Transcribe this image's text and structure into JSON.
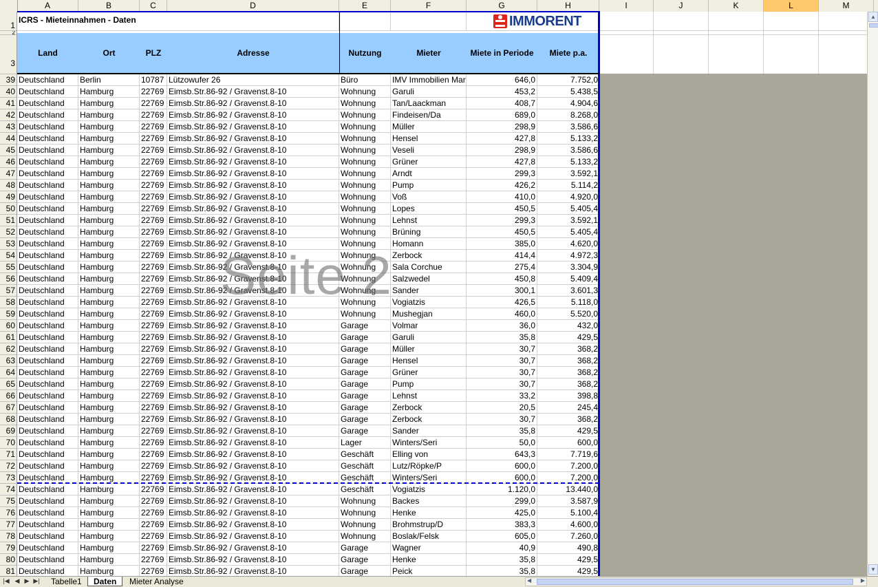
{
  "columns": [
    "A",
    "B",
    "C",
    "D",
    "E",
    "F",
    "G",
    "H",
    "I",
    "J",
    "K",
    "L",
    "M"
  ],
  "active_column": "L",
  "title_cell": "ICRS - Mieteinnahmen - Daten",
  "logo_text": "IMMORENT",
  "header_rows": [
    "1",
    "2",
    "3"
  ],
  "headers": [
    "Land",
    "Ort",
    "PLZ",
    "Adresse",
    "Nutzung",
    "Mieter",
    "Miete in Periode",
    "Miete p.a."
  ],
  "watermark": "Seite 2",
  "rows": [
    {
      "n": "39",
      "land": "Deutschland",
      "ort": "Berlin",
      "plz": "10787",
      "adr": "Lützowufer 26",
      "nutz": "Büro",
      "mieter": "IMV Immobilien Mar",
      "periode": "646,0",
      "pa": "7.752,0"
    },
    {
      "n": "40",
      "land": "Deutschland",
      "ort": "Hamburg",
      "plz": "22769",
      "adr": "Eimsb.Str.86-92 / Gravenst.8-10",
      "nutz": "Wohnung",
      "mieter": "Garuli",
      "periode": "453,2",
      "pa": "5.438,5"
    },
    {
      "n": "41",
      "land": "Deutschland",
      "ort": "Hamburg",
      "plz": "22769",
      "adr": "Eimsb.Str.86-92 / Gravenst.8-10",
      "nutz": "Wohnung",
      "mieter": "Tan/Laackman",
      "periode": "408,7",
      "pa": "4.904,6"
    },
    {
      "n": "42",
      "land": "Deutschland",
      "ort": "Hamburg",
      "plz": "22769",
      "adr": "Eimsb.Str.86-92 / Gravenst.8-10",
      "nutz": "Wohnung",
      "mieter": "Findeisen/Da",
      "periode": "689,0",
      "pa": "8.268,0"
    },
    {
      "n": "43",
      "land": "Deutschland",
      "ort": "Hamburg",
      "plz": "22769",
      "adr": "Eimsb.Str.86-92 / Gravenst.8-10",
      "nutz": "Wohnung",
      "mieter": "Müller",
      "periode": "298,9",
      "pa": "3.586,6"
    },
    {
      "n": "44",
      "land": "Deutschland",
      "ort": "Hamburg",
      "plz": "22769",
      "adr": "Eimsb.Str.86-92 / Gravenst.8-10",
      "nutz": "Wohnung",
      "mieter": "Hensel",
      "periode": "427,8",
      "pa": "5.133,2"
    },
    {
      "n": "45",
      "land": "Deutschland",
      "ort": "Hamburg",
      "plz": "22769",
      "adr": "Eimsb.Str.86-92 / Gravenst.8-10",
      "nutz": "Wohnung",
      "mieter": "Veseli",
      "periode": "298,9",
      "pa": "3.586,6"
    },
    {
      "n": "46",
      "land": "Deutschland",
      "ort": "Hamburg",
      "plz": "22769",
      "adr": "Eimsb.Str.86-92 / Gravenst.8-10",
      "nutz": "Wohnung",
      "mieter": "Grüner",
      "periode": "427,8",
      "pa": "5.133,2"
    },
    {
      "n": "47",
      "land": "Deutschland",
      "ort": "Hamburg",
      "plz": "22769",
      "adr": "Eimsb.Str.86-92 / Gravenst.8-10",
      "nutz": "Wohnung",
      "mieter": "Arndt",
      "periode": "299,3",
      "pa": "3.592,1"
    },
    {
      "n": "48",
      "land": "Deutschland",
      "ort": "Hamburg",
      "plz": "22769",
      "adr": "Eimsb.Str.86-92 / Gravenst.8-10",
      "nutz": "Wohnung",
      "mieter": "Pump",
      "periode": "426,2",
      "pa": "5.114,2"
    },
    {
      "n": "49",
      "land": "Deutschland",
      "ort": "Hamburg",
      "plz": "22769",
      "adr": "Eimsb.Str.86-92 / Gravenst.8-10",
      "nutz": "Wohnung",
      "mieter": "Voß",
      "periode": "410,0",
      "pa": "4.920,0"
    },
    {
      "n": "50",
      "land": "Deutschland",
      "ort": "Hamburg",
      "plz": "22769",
      "adr": "Eimsb.Str.86-92 / Gravenst.8-10",
      "nutz": "Wohnung",
      "mieter": "Lopes",
      "periode": "450,5",
      "pa": "5.405,4"
    },
    {
      "n": "51",
      "land": "Deutschland",
      "ort": "Hamburg",
      "plz": "22769",
      "adr": "Eimsb.Str.86-92 / Gravenst.8-10",
      "nutz": "Wohnung",
      "mieter": "Lehnst",
      "periode": "299,3",
      "pa": "3.592,1"
    },
    {
      "n": "52",
      "land": "Deutschland",
      "ort": "Hamburg",
      "plz": "22769",
      "adr": "Eimsb.Str.86-92 / Gravenst.8-10",
      "nutz": "Wohnung",
      "mieter": "Brüning",
      "periode": "450,5",
      "pa": "5.405,4"
    },
    {
      "n": "53",
      "land": "Deutschland",
      "ort": "Hamburg",
      "plz": "22769",
      "adr": "Eimsb.Str.86-92 / Gravenst.8-10",
      "nutz": "Wohnung",
      "mieter": "Homann",
      "periode": "385,0",
      "pa": "4.620,0"
    },
    {
      "n": "54",
      "land": "Deutschland",
      "ort": "Hamburg",
      "plz": "22769",
      "adr": "Eimsb.Str.86-92 / Gravenst.8-10",
      "nutz": "Wohnung",
      "mieter": "Zerbock",
      "periode": "414,4",
      "pa": "4.972,3"
    },
    {
      "n": "55",
      "land": "Deutschland",
      "ort": "Hamburg",
      "plz": "22769",
      "adr": "Eimsb.Str.86-92 / Gravenst.8-10",
      "nutz": "Wohnung",
      "mieter": "Sala Corchue",
      "periode": "275,4",
      "pa": "3.304,9"
    },
    {
      "n": "56",
      "land": "Deutschland",
      "ort": "Hamburg",
      "plz": "22769",
      "adr": "Eimsb.Str.86-92 / Gravenst.8-10",
      "nutz": "Wohnung",
      "mieter": "Salzwedel",
      "periode": "450,8",
      "pa": "5.409,4"
    },
    {
      "n": "57",
      "land": "Deutschland",
      "ort": "Hamburg",
      "plz": "22769",
      "adr": "Eimsb.Str.86-92 / Gravenst.8-10",
      "nutz": "Wohnung",
      "mieter": "Sander",
      "periode": "300,1",
      "pa": "3.601,3"
    },
    {
      "n": "58",
      "land": "Deutschland",
      "ort": "Hamburg",
      "plz": "22769",
      "adr": "Eimsb.Str.86-92 / Gravenst.8-10",
      "nutz": "Wohnung",
      "mieter": "Vogiatzis",
      "periode": "426,5",
      "pa": "5.118,0"
    },
    {
      "n": "59",
      "land": "Deutschland",
      "ort": "Hamburg",
      "plz": "22769",
      "adr": "Eimsb.Str.86-92 / Gravenst.8-10",
      "nutz": "Wohnung",
      "mieter": "Mushegjan",
      "periode": "460,0",
      "pa": "5.520,0"
    },
    {
      "n": "60",
      "land": "Deutschland",
      "ort": "Hamburg",
      "plz": "22769",
      "adr": "Eimsb.Str.86-92 / Gravenst.8-10",
      "nutz": "Garage",
      "mieter": "Volmar",
      "periode": "36,0",
      "pa": "432,0"
    },
    {
      "n": "61",
      "land": "Deutschland",
      "ort": "Hamburg",
      "plz": "22769",
      "adr": "Eimsb.Str.86-92 / Gravenst.8-10",
      "nutz": "Garage",
      "mieter": "Garuli",
      "periode": "35,8",
      "pa": "429,5"
    },
    {
      "n": "62",
      "land": "Deutschland",
      "ort": "Hamburg",
      "plz": "22769",
      "adr": "Eimsb.Str.86-92 / Gravenst.8-10",
      "nutz": "Garage",
      "mieter": "Müller",
      "periode": "30,7",
      "pa": "368,2"
    },
    {
      "n": "63",
      "land": "Deutschland",
      "ort": "Hamburg",
      "plz": "22769",
      "adr": "Eimsb.Str.86-92 / Gravenst.8-10",
      "nutz": "Garage",
      "mieter": "Hensel",
      "periode": "30,7",
      "pa": "368,2"
    },
    {
      "n": "64",
      "land": "Deutschland",
      "ort": "Hamburg",
      "plz": "22769",
      "adr": "Eimsb.Str.86-92 / Gravenst.8-10",
      "nutz": "Garage",
      "mieter": "Grüner",
      "periode": "30,7",
      "pa": "368,2"
    },
    {
      "n": "65",
      "land": "Deutschland",
      "ort": "Hamburg",
      "plz": "22769",
      "adr": "Eimsb.Str.86-92 / Gravenst.8-10",
      "nutz": "Garage",
      "mieter": "Pump",
      "periode": "30,7",
      "pa": "368,2"
    },
    {
      "n": "66",
      "land": "Deutschland",
      "ort": "Hamburg",
      "plz": "22769",
      "adr": "Eimsb.Str.86-92 / Gravenst.8-10",
      "nutz": "Garage",
      "mieter": "Lehnst",
      "periode": "33,2",
      "pa": "398,8"
    },
    {
      "n": "67",
      "land": "Deutschland",
      "ort": "Hamburg",
      "plz": "22769",
      "adr": "Eimsb.Str.86-92 / Gravenst.8-10",
      "nutz": "Garage",
      "mieter": "Zerbock",
      "periode": "20,5",
      "pa": "245,4"
    },
    {
      "n": "68",
      "land": "Deutschland",
      "ort": "Hamburg",
      "plz": "22769",
      "adr": "Eimsb.Str.86-92 / Gravenst.8-10",
      "nutz": "Garage",
      "mieter": "Zerbock",
      "periode": "30,7",
      "pa": "368,2"
    },
    {
      "n": "69",
      "land": "Deutschland",
      "ort": "Hamburg",
      "plz": "22769",
      "adr": "Eimsb.Str.86-92 / Gravenst.8-10",
      "nutz": "Garage",
      "mieter": "Sander",
      "periode": "35,8",
      "pa": "429,5"
    },
    {
      "n": "70",
      "land": "Deutschland",
      "ort": "Hamburg",
      "plz": "22769",
      "adr": "Eimsb.Str.86-92 / Gravenst.8-10",
      "nutz": "Lager",
      "mieter": "Winters/Seri",
      "periode": "50,0",
      "pa": "600,0"
    },
    {
      "n": "71",
      "land": "Deutschland",
      "ort": "Hamburg",
      "plz": "22769",
      "adr": "Eimsb.Str.86-92 / Gravenst.8-10",
      "nutz": "Geschäft",
      "mieter": "Elling von",
      "periode": "643,3",
      "pa": "7.719,6"
    },
    {
      "n": "72",
      "land": "Deutschland",
      "ort": "Hamburg",
      "plz": "22769",
      "adr": "Eimsb.Str.86-92 / Gravenst.8-10",
      "nutz": "Geschäft",
      "mieter": "Lutz/Röpke/P",
      "periode": "600,0",
      "pa": "7.200,0"
    },
    {
      "n": "73",
      "land": "Deutschland",
      "ort": "Hamburg",
      "plz": "22769",
      "adr": "Eimsb.Str.86-92 / Gravenst.8-10",
      "nutz": "Geschäft",
      "mieter": "Winters/Seri",
      "periode": "600,0",
      "pa": "7.200,0"
    },
    {
      "n": "74",
      "land": "Deutschland",
      "ort": "Hamburg",
      "plz": "22769",
      "adr": "Eimsb.Str.86-92 / Gravenst.8-10",
      "nutz": "Geschäft",
      "mieter": "Vogiatzis",
      "periode": "1.120,0",
      "pa": "13.440,0"
    },
    {
      "n": "75",
      "land": "Deutschland",
      "ort": "Hamburg",
      "plz": "22769",
      "adr": "Eimsb.Str.86-92 / Gravenst.8-10",
      "nutz": "Wohnung",
      "mieter": "Backes",
      "periode": "299,0",
      "pa": "3.587,9"
    },
    {
      "n": "76",
      "land": "Deutschland",
      "ort": "Hamburg",
      "plz": "22769",
      "adr": "Eimsb.Str.86-92 / Gravenst.8-10",
      "nutz": "Wohnung",
      "mieter": "Henke",
      "periode": "425,0",
      "pa": "5.100,4"
    },
    {
      "n": "77",
      "land": "Deutschland",
      "ort": "Hamburg",
      "plz": "22769",
      "adr": "Eimsb.Str.86-92 / Gravenst.8-10",
      "nutz": "Wohnung",
      "mieter": "Brohmstrup/D",
      "periode": "383,3",
      "pa": "4.600,0"
    },
    {
      "n": "78",
      "land": "Deutschland",
      "ort": "Hamburg",
      "plz": "22769",
      "adr": "Eimsb.Str.86-92 / Gravenst.8-10",
      "nutz": "Wohnung",
      "mieter": "Boslak/Felsk",
      "periode": "605,0",
      "pa": "7.260,0"
    },
    {
      "n": "79",
      "land": "Deutschland",
      "ort": "Hamburg",
      "plz": "22769",
      "adr": "Eimsb.Str.86-92 / Gravenst.8-10",
      "nutz": "Garage",
      "mieter": "Wagner",
      "periode": "40,9",
      "pa": "490,8"
    },
    {
      "n": "80",
      "land": "Deutschland",
      "ort": "Hamburg",
      "plz": "22769",
      "adr": "Eimsb.Str.86-92 / Gravenst.8-10",
      "nutz": "Garage",
      "mieter": "Henke",
      "periode": "35,8",
      "pa": "429,5"
    },
    {
      "n": "81",
      "land": "Deutschland",
      "ort": "Hamburg",
      "plz": "22769",
      "adr": "Eimsb.Str.86-92 / Gravenst.8-10",
      "nutz": "Garage",
      "mieter": "Peick",
      "periode": "35,8",
      "pa": "429,5"
    }
  ],
  "page_break_after_row": "73",
  "sheet_tabs": [
    {
      "label": "Tabelle1",
      "active": false
    },
    {
      "label": "Daten",
      "active": true
    },
    {
      "label": "Mieter Analyse",
      "active": false
    }
  ],
  "nav_icons": [
    "first-sheet-icon",
    "prev-sheet-icon",
    "next-sheet-icon",
    "last-sheet-icon"
  ],
  "colors": {
    "header_fill": "#99ccff",
    "print_border": "#0000cc",
    "outside_area": "#a9a69a",
    "logo_red": "#e2231a",
    "logo_blue": "#1a3a8c"
  }
}
